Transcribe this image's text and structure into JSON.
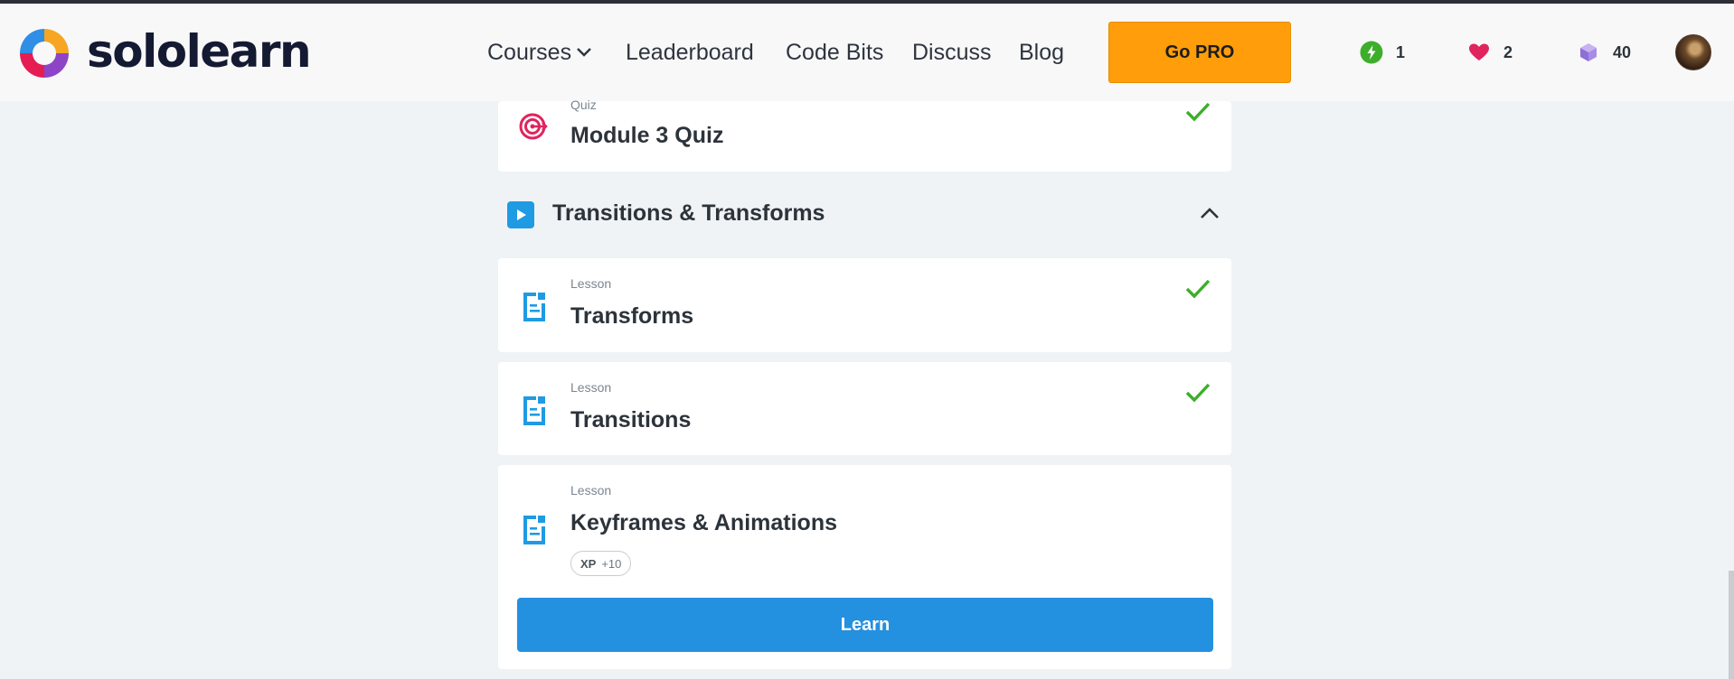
{
  "brand": {
    "name": "sololearn"
  },
  "nav": {
    "courses": "Courses",
    "leaderboard": "Leaderboard",
    "code_bits": "Code Bits",
    "discuss": "Discuss",
    "blog": "Blog",
    "go_pro": "Go PRO"
  },
  "stats": {
    "streak": "1",
    "hearts": "2",
    "bits": "40"
  },
  "colors": {
    "accent": "#2490e0",
    "pro": "#ff9d0a",
    "check": "#3dae2b",
    "quiz": "#e0245e"
  },
  "quiz_card": {
    "type": "Quiz",
    "title": "Module 3 Quiz",
    "icon": "target-icon",
    "completed": true
  },
  "section": {
    "title": "Transitions & Transforms",
    "expanded": true
  },
  "lessons": [
    {
      "type": "Lesson",
      "title": "Transforms",
      "icon": "lesson-doc-icon",
      "completed": true
    },
    {
      "type": "Lesson",
      "title": "Transitions",
      "icon": "lesson-doc-icon",
      "completed": true
    },
    {
      "type": "Lesson",
      "title": "Keyframes & Animations",
      "icon": "lesson-doc-icon",
      "completed": false,
      "xp_label": "XP",
      "xp_value": "+10",
      "action": "Learn"
    }
  ]
}
